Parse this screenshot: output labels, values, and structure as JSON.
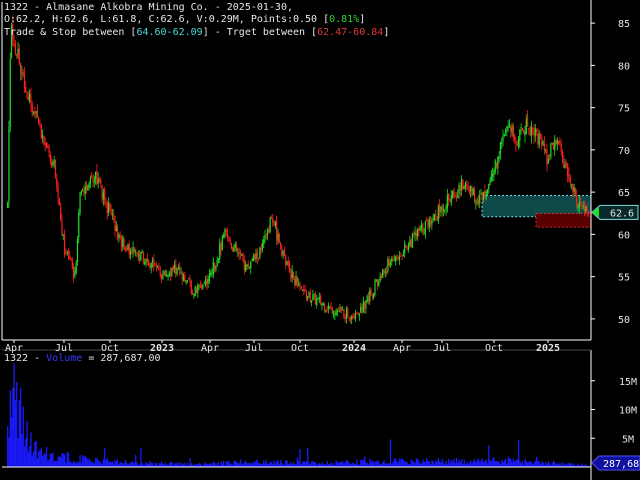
{
  "header": {
    "line1": "1322 - Almasane Alkobra Mining Co. - 2025-01-30,",
    "ohlc_text": "O:62.2, H:62.6, L:61.8, C:62.6, V:0.29M, Points:0.50 [",
    "change": "0.81%",
    "close_bracket": "]",
    "trade_label": "Trade & Stop between [",
    "trade_range": "64.60-62.09",
    "target_label": "] - Trget between [",
    "target_range": "62.47-60.84",
    "end_bracket": "]"
  },
  "volume_header": {
    "symbol": "1322 -",
    "label": "Volume",
    "eq": "= 287,687.00"
  },
  "colors": {
    "background": "#000000",
    "up": "#22dd22",
    "down": "#ff2020",
    "trade_zone": "#0e4a4a",
    "target_zone": "#5a0000",
    "volume": "#1a1aff",
    "axis": "#ffffff",
    "text": "#e6e6e6"
  },
  "chart_data": [
    {
      "type": "candlestick",
      "price_axis_ticks": [
        50,
        55,
        60,
        65,
        70,
        75,
        80,
        85
      ],
      "ylim": [
        47.5,
        87.5
      ],
      "x_tick_labels": [
        "Apr",
        "Jul",
        "Oct",
        "2023",
        "Apr",
        "Jul",
        "Oct",
        "2024",
        "Apr",
        "Jul",
        "Oct",
        "2025"
      ],
      "last_price": "62.6",
      "trade_zone": [
        62.09,
        64.6
      ],
      "target_zone": [
        60.84,
        62.47
      ],
      "close_path_approx": [
        [
          0,
          63
        ],
        [
          0.3,
          85
        ],
        [
          1.5,
          78
        ],
        [
          3,
          73
        ],
        [
          4.5,
          68
        ],
        [
          5.5,
          58
        ],
        [
          6.5,
          55
        ],
        [
          7,
          65
        ],
        [
          8.5,
          67
        ],
        [
          10,
          62
        ],
        [
          11,
          59
        ],
        [
          12,
          58
        ],
        [
          13.5,
          57
        ],
        [
          15,
          55
        ],
        [
          16.5,
          56
        ],
        [
          18,
          53
        ],
        [
          19.5,
          55
        ],
        [
          21,
          60
        ],
        [
          22,
          58
        ],
        [
          23,
          56
        ],
        [
          24.5,
          58
        ],
        [
          25.5,
          62
        ],
        [
          27,
          56
        ],
        [
          28.5,
          53
        ],
        [
          30,
          52
        ],
        [
          31.5,
          51
        ],
        [
          33,
          50.5
        ],
        [
          34,
          51
        ],
        [
          35,
          53
        ],
        [
          36,
          55
        ],
        [
          37,
          57
        ],
        [
          38,
          58
        ],
        [
          39.5,
          60
        ],
        [
          41,
          62
        ],
        [
          42.5,
          64
        ],
        [
          44,
          66
        ],
        [
          45.5,
          64
        ],
        [
          47,
          68
        ],
        [
          48,
          73
        ],
        [
          49,
          71
        ],
        [
          50,
          73
        ],
        [
          51,
          72
        ],
        [
          52,
          69
        ],
        [
          53,
          71
        ],
        [
          54,
          67
        ],
        [
          55,
          63.5
        ],
        [
          56,
          62.6
        ]
      ]
    },
    {
      "type": "bar",
      "title": "Volume",
      "y_tick_labels": [
        "5M",
        "10M",
        "15M"
      ],
      "last_value_label": "287,687",
      "volume_path_approx": [
        [
          0,
          6
        ],
        [
          0.3,
          17
        ],
        [
          1,
          11
        ],
        [
          2,
          5
        ],
        [
          3,
          2.5
        ],
        [
          5,
          2
        ],
        [
          8,
          1.2
        ],
        [
          12,
          0.8
        ],
        [
          18,
          0.6
        ],
        [
          24,
          0.9
        ],
        [
          30,
          0.7
        ],
        [
          36,
          1
        ],
        [
          42,
          1.1
        ],
        [
          48,
          1.2
        ],
        [
          54,
          0.6
        ],
        [
          56,
          0.3
        ]
      ]
    }
  ]
}
